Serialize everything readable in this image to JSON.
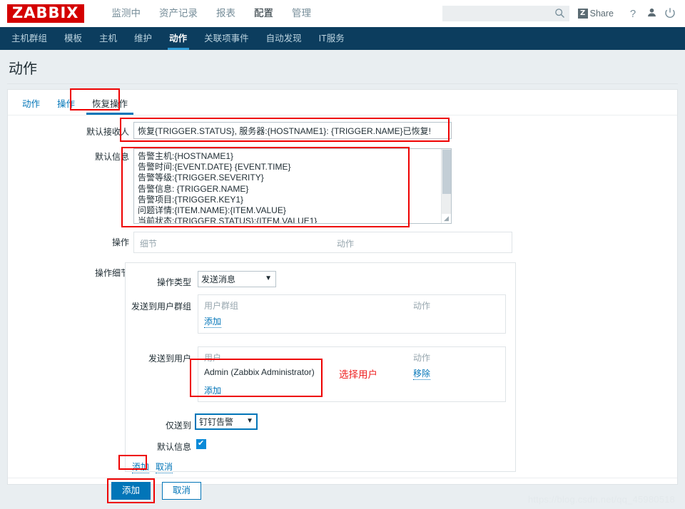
{
  "brand": {
    "logo": "ZABBIX",
    "logo_color": "#d40000"
  },
  "header": {
    "menu": [
      {
        "label": "监测中",
        "selected": false
      },
      {
        "label": "资产记录",
        "selected": false
      },
      {
        "label": "报表",
        "selected": false
      },
      {
        "label": "配置",
        "selected": true
      },
      {
        "label": "管理",
        "selected": false
      }
    ],
    "search": {
      "value": "",
      "placeholder": ""
    },
    "search_icon": "search-icon",
    "share": {
      "badge": "Z",
      "label": "Share"
    },
    "help_icon": "?",
    "user_icon": "user-icon",
    "power_icon": "power-icon"
  },
  "subnav": {
    "items": [
      {
        "label": "主机群组",
        "selected": false
      },
      {
        "label": "模板",
        "selected": false
      },
      {
        "label": "主机",
        "selected": false
      },
      {
        "label": "维护",
        "selected": false
      },
      {
        "label": "动作",
        "selected": true
      },
      {
        "label": "关联项事件",
        "selected": false
      },
      {
        "label": "自动发现",
        "selected": false
      },
      {
        "label": "IT服务",
        "selected": false
      }
    ]
  },
  "page": {
    "title": "动作"
  },
  "tabs": [
    {
      "label": "动作",
      "active": false
    },
    {
      "label": "操作",
      "active": false
    },
    {
      "label": "恢复操作",
      "active": true
    }
  ],
  "form": {
    "default_subject": {
      "label": "默认接收人",
      "value": "恢复{TRIGGER.STATUS}, 服务器:{HOSTNAME1}: {TRIGGER.NAME}已恢复!"
    },
    "default_message": {
      "label": "默认信息",
      "value": "告警主机:{HOSTNAME1}\n告警时间:{EVENT.DATE} {EVENT.TIME}\n告警等级:{TRIGGER.SEVERITY}\n告警信息: {TRIGGER.NAME}\n告警项目:{TRIGGER.KEY1}\n问题详情:{ITEM.NAME}:{ITEM.VALUE}\n当前状态:{TRIGGER.STATUS}:{ITEM.VALUE1}"
    },
    "operations": {
      "label": "操作",
      "col_details": "细节",
      "col_action": "动作"
    },
    "operation_details": {
      "label": "操作细节",
      "operation_type": {
        "label": "操作类型",
        "value": "发送消息",
        "options": [
          "发送消息"
        ]
      },
      "send_to_user_groups": {
        "label": "发送到用户群组",
        "col_group": "用户群组",
        "col_action": "动作",
        "add_link": "添加",
        "rows": []
      },
      "send_to_users": {
        "label": "发送到用户",
        "col_user": "用户",
        "col_action": "动作",
        "add_link": "添加",
        "rows": [
          {
            "user": "Admin (Zabbix Administrator)",
            "action": "移除"
          }
        ]
      },
      "send_only_to": {
        "label": "仅送到",
        "value": "钉钉告警",
        "options": [
          "钉钉告警"
        ]
      },
      "default_message": {
        "label": "默认信息",
        "checked": true
      },
      "inline_add": "添加",
      "inline_cancel": "取消"
    },
    "footer": {
      "add": "添加",
      "cancel": "取消"
    }
  },
  "annotations": {
    "select_user_note": "选择用户",
    "color": "#ee0000"
  },
  "watermark": "https://blog.csdn.net/qq_45980518"
}
